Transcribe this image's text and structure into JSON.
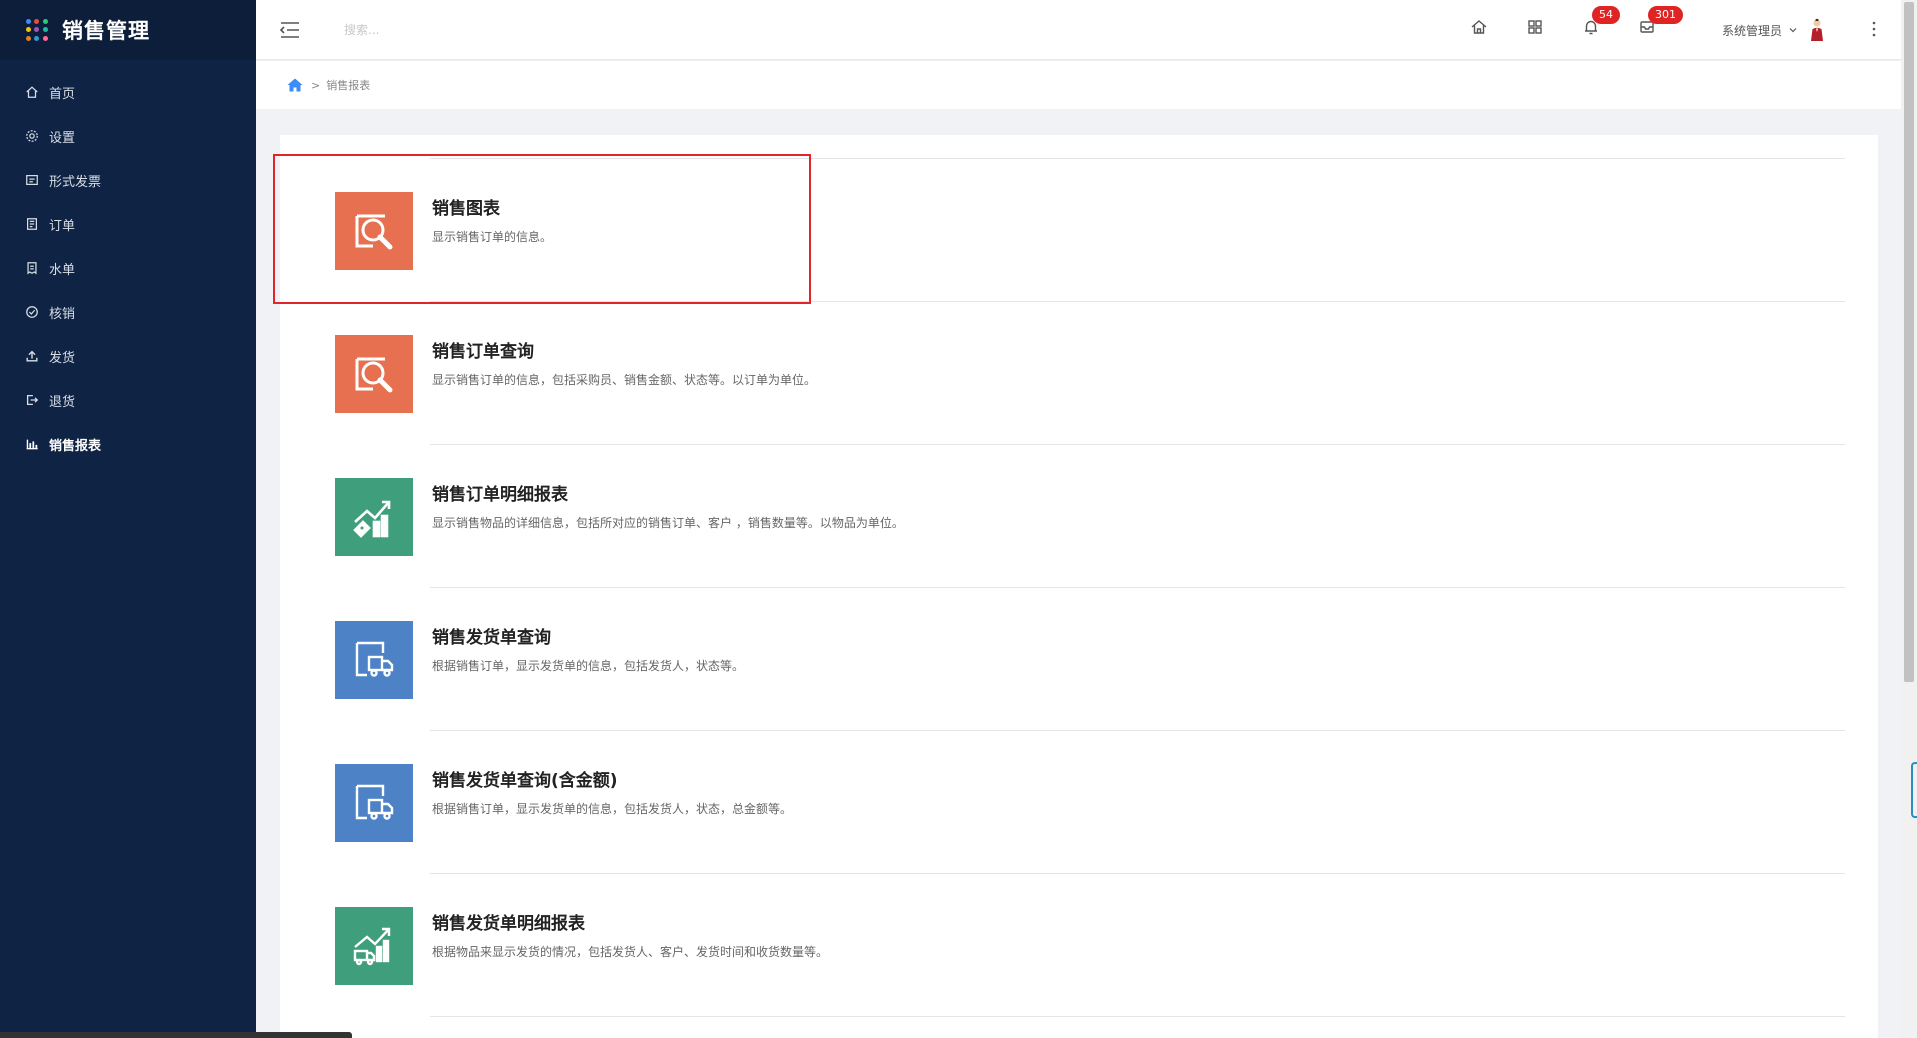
{
  "app": {
    "title": "销售管理",
    "brand_colors": [
      "#3a8ef6",
      "#e74c3c",
      "#2ecc71",
      "#f1c40f",
      "#9b59b6",
      "#1abc9c",
      "#e67e22",
      "#3498db",
      "#ff6b9a"
    ]
  },
  "sidebar": {
    "items": [
      {
        "label": "首页",
        "icon": "home-icon",
        "active": false
      },
      {
        "label": "设置",
        "icon": "gear-icon",
        "active": false
      },
      {
        "label": "形式发票",
        "icon": "invoice-icon",
        "active": false
      },
      {
        "label": "订单",
        "icon": "order-icon",
        "active": false
      },
      {
        "label": "水单",
        "icon": "receipt-icon",
        "active": false
      },
      {
        "label": "核销",
        "icon": "check-circle-icon",
        "active": false
      },
      {
        "label": "发货",
        "icon": "upload-icon",
        "active": false
      },
      {
        "label": "退货",
        "icon": "return-icon",
        "active": false
      },
      {
        "label": "销售报表",
        "icon": "bar-chart-icon",
        "active": true
      }
    ]
  },
  "header": {
    "search_placeholder": "搜索...",
    "notifications_count": "54",
    "messages_count": "301",
    "user_name": "系统管理员"
  },
  "breadcrumb": {
    "separator": ">",
    "current": "销售报表"
  },
  "reports": [
    {
      "title": "销售图表",
      "desc": "显示销售订单的信息。",
      "icon": "search-doc-icon",
      "color": "#e6704f"
    },
    {
      "title": "销售订单查询",
      "desc": "显示销售订单的信息，包括采购员、销售金额、状态等。以订单为单位。",
      "icon": "search-doc-icon",
      "color": "#e6704f"
    },
    {
      "title": "销售订单明细报表",
      "desc": "显示销售物品的详细信息，包括所对应的销售订单、客户 ，销售数量等。以物品为单位。",
      "icon": "sales-chart-tag-icon",
      "color": "#3f9e7c"
    },
    {
      "title": "销售发货单查询",
      "desc": "根据销售订单，显示发货单的信息，包括发货人，状态等。",
      "icon": "truck-doc-icon",
      "color": "#4d82c7"
    },
    {
      "title": "销售发货单查询(含金额)",
      "desc": "根据销售订单，显示发货单的信息，包括发货人，状态，总金额等。",
      "icon": "truck-doc-icon",
      "color": "#4d82c7"
    },
    {
      "title": "销售发货单明细报表",
      "desc": "根据物品来显示发货的情况，包括发货人、客户、发货时间和收货数量等。",
      "icon": "truck-chart-icon",
      "color": "#3f9e7c"
    }
  ]
}
